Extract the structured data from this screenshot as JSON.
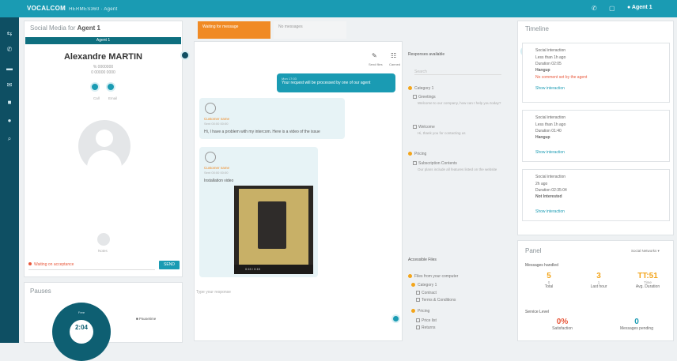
{
  "topbar": {
    "brand": "VOCALCOM",
    "brand_sub": "HERMES360 · Agent",
    "agent": "Agent 1"
  },
  "left_panel": {
    "title_prefix": "Social Media for",
    "title_agent": "Agent 1",
    "contact_bar": "Agent 1",
    "contact_name": "Alexandre MARTIN",
    "contact_phone": "% 0000000",
    "contact_extra": "0 00000 0000",
    "btn1_label": "Call",
    "btn2_label": "Email",
    "media_label": "Notes",
    "status_text": "Waiting on acceptance",
    "send_label": "SEND"
  },
  "pauses": {
    "title": "Pauses",
    "gauge_label": "Free",
    "gauge_value": "2:04",
    "legend_label": "Pausetime"
  },
  "chat": {
    "tab_active": "Waiting for message",
    "tab_inactive": "No messages",
    "bubble_out": "Your request will be processed by one of our agent",
    "bubble_time": "Mon 17:03",
    "msg1_sender": "Customer name",
    "msg1_time": "Sent 00:00 00:00",
    "msg1_text": "Hi, I have a problem with my intercom. Here is a video of the issue",
    "msg2_sender": "Customer name",
    "msg2_time": "Sent 00:00 00:00",
    "msg2_text": "Installation video",
    "video_time": "0:15 / 0:15",
    "compose_placeholder": "Type your response"
  },
  "responses": {
    "title": "Responses available",
    "search_placeholder": "Search",
    "tool1": "Send files",
    "tool2": "Canned",
    "cat1": "Category 1",
    "item1": "Greetings",
    "item1_desc": "Welcome to our company, how can I help you today?",
    "item2": "Welcome",
    "item2_desc": "Hi, thank you for contacting us",
    "cat2": "Pricing",
    "item3": "Subscription Contents",
    "item3_desc": "Our plans include all features listed on the website",
    "accessible_title": "Accessible Files",
    "file_cat": "Files from your computer",
    "file_cat2": "Category 1",
    "file1": "Contract",
    "file2": "Terms & Conditions",
    "file_cat3": "Pricing",
    "file3": "Price list",
    "file4": "Returns"
  },
  "timeline": {
    "title": "Timeline",
    "cards": [
      {
        "title": "Social interaction",
        "l1": "Less than 1h ago",
        "l2": "Duration 02:05",
        "l3": "Hangup",
        "l4": "No comment set by the agent",
        "link": "Show interaction"
      },
      {
        "title": "Social interaction",
        "l1": "Less than 1h ago",
        "l2": "Duration 01:40",
        "l3": "Hangup",
        "link": "Show interaction"
      },
      {
        "title": "Social interaction",
        "l1": "2h ago",
        "l2": "Duration 02:35:04",
        "l3": "Not Interested",
        "link": "Show interaction"
      }
    ]
  },
  "panel_stats": {
    "title": "Panel",
    "dropdown": "Social Networks",
    "messages_title": "Messages handled",
    "kpis": [
      {
        "value": "5",
        "sub": "0",
        "label": "Total"
      },
      {
        "value": "3",
        "sub": "1",
        "label": "Last hour"
      },
      {
        "value": "TT:51",
        "sub": "Time",
        "label": "Avg. Duration"
      }
    ],
    "service_title": "Service Level",
    "service": [
      {
        "value": "0%",
        "label": "Satisfaction",
        "color": "#e8573a"
      },
      {
        "value": "0",
        "label": "Messages pending",
        "color": "#1a9bb3"
      }
    ]
  },
  "colors": {
    "primary": "#1a9bb3",
    "dark": "#0e4f63",
    "accent": "#f08a24",
    "alert": "#e8573a"
  },
  "icons": [
    "menu-icon",
    "phone-icon",
    "chat-icon",
    "mail-icon",
    "settings-icon",
    "search-icon",
    "user-icon",
    "video-icon"
  ]
}
